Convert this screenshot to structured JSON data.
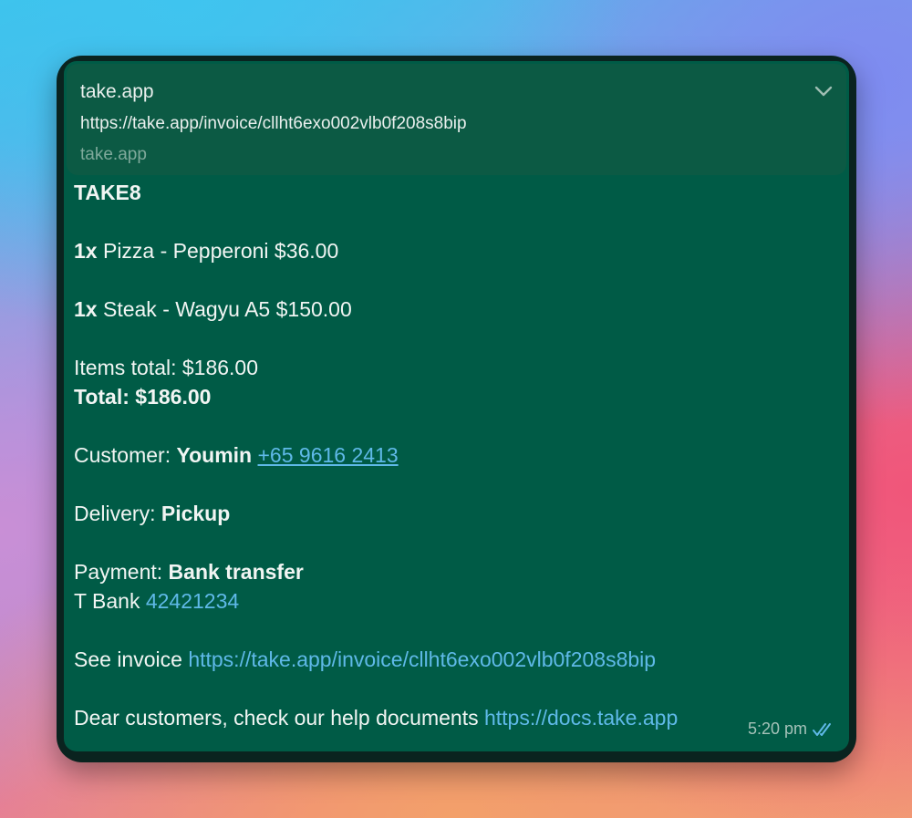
{
  "link_preview": {
    "title": "take.app",
    "url": "https://take.app/invoice/cllht6exo002vlb0f208s8bip",
    "domain": "take.app",
    "expand_icon": "chevron-down-icon"
  },
  "message": {
    "store_name": "TAKE8",
    "items": [
      {
        "qty": "1x",
        "text": "Pizza - Pepperoni $36.00"
      },
      {
        "qty": "1x",
        "text": "Steak - Wagyu A5 $150.00"
      }
    ],
    "items_total": "Items total: $186.00",
    "total": "Total: $186.00",
    "customer_label": "Customer:",
    "customer_name": "Youmin",
    "customer_phone": "+65 9616 2413",
    "delivery_label": "Delivery:",
    "delivery_value": "Pickup",
    "payment_label": "Payment:",
    "payment_value": "Bank transfer",
    "bank_label": "T Bank",
    "bank_account": "42421234",
    "invoice_label": "See invoice",
    "invoice_url": "https://take.app/invoice/cllht6exo002vlb0f208s8bip",
    "help_text": "Dear customers, check our help documents",
    "help_url": "https://docs.take.app"
  },
  "meta": {
    "time": "5:20 pm",
    "status_icon": "double-check-icon"
  },
  "colors": {
    "bubble": "#005b46",
    "preview": "#0c5a44",
    "link": "#5fb9e8",
    "text": "#f1f5f3"
  }
}
